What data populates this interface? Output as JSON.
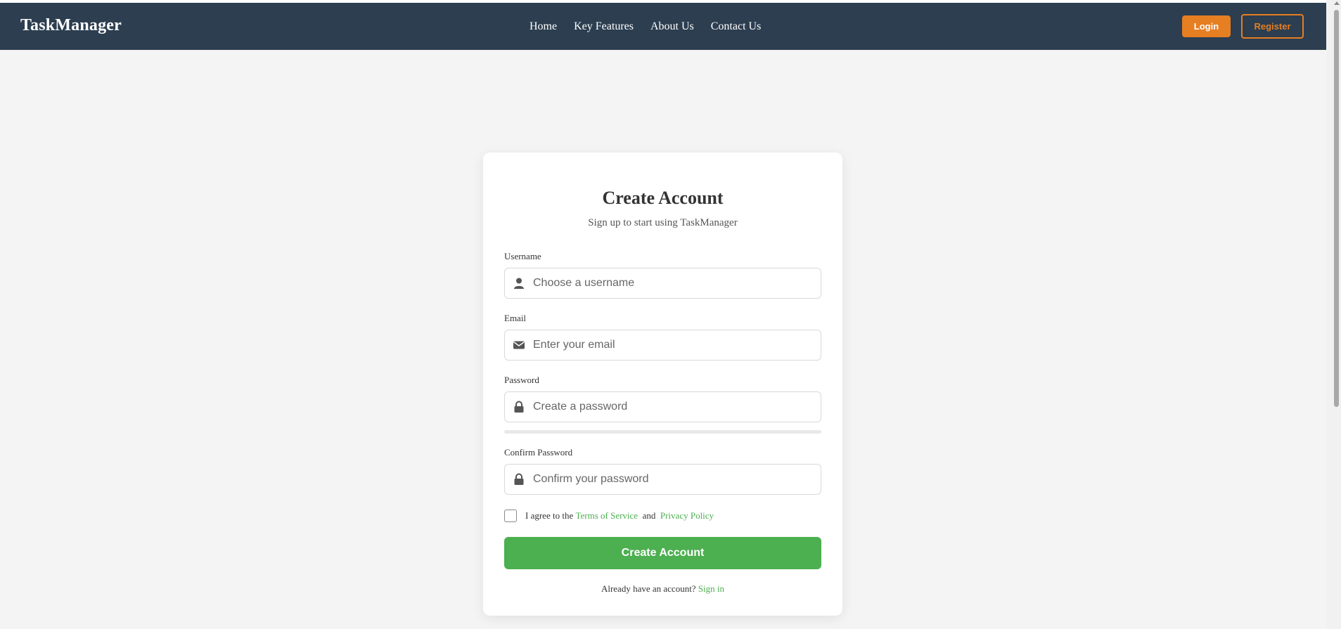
{
  "navbar": {
    "brand": "TaskManager",
    "links": [
      "Home",
      "Key Features",
      "About Us",
      "Contact Us"
    ],
    "login_label": "Login",
    "register_label": "Register"
  },
  "form": {
    "title": "Create Account",
    "subtitle": "Sign up to start using TaskManager",
    "username": {
      "label": "Username",
      "placeholder": "Choose a username",
      "value": "",
      "icon": "user-icon"
    },
    "email": {
      "label": "Email",
      "placeholder": "Enter your email",
      "value": "",
      "icon": "envelope-icon"
    },
    "password": {
      "label": "Password",
      "placeholder": "Create a password",
      "value": "",
      "icon": "lock-icon",
      "strength": 0
    },
    "confirm_password": {
      "label": "Confirm Password",
      "placeholder": "Confirm your password",
      "value": "",
      "icon": "lock-icon"
    },
    "terms": {
      "checked": false,
      "prefix": "I agree to the ",
      "terms_link": "Terms of Service",
      "conjunction": "  and  ",
      "privacy_link": "Privacy Policy"
    },
    "submit_label": "Create Account",
    "signin_prompt": "Already have an account? ",
    "signin_link": "Sign in"
  },
  "colors": {
    "navbar_bg": "#2c3e50",
    "accent_orange": "#e67e22",
    "accent_green": "#4caf50",
    "page_bg": "#f4f4f4"
  }
}
